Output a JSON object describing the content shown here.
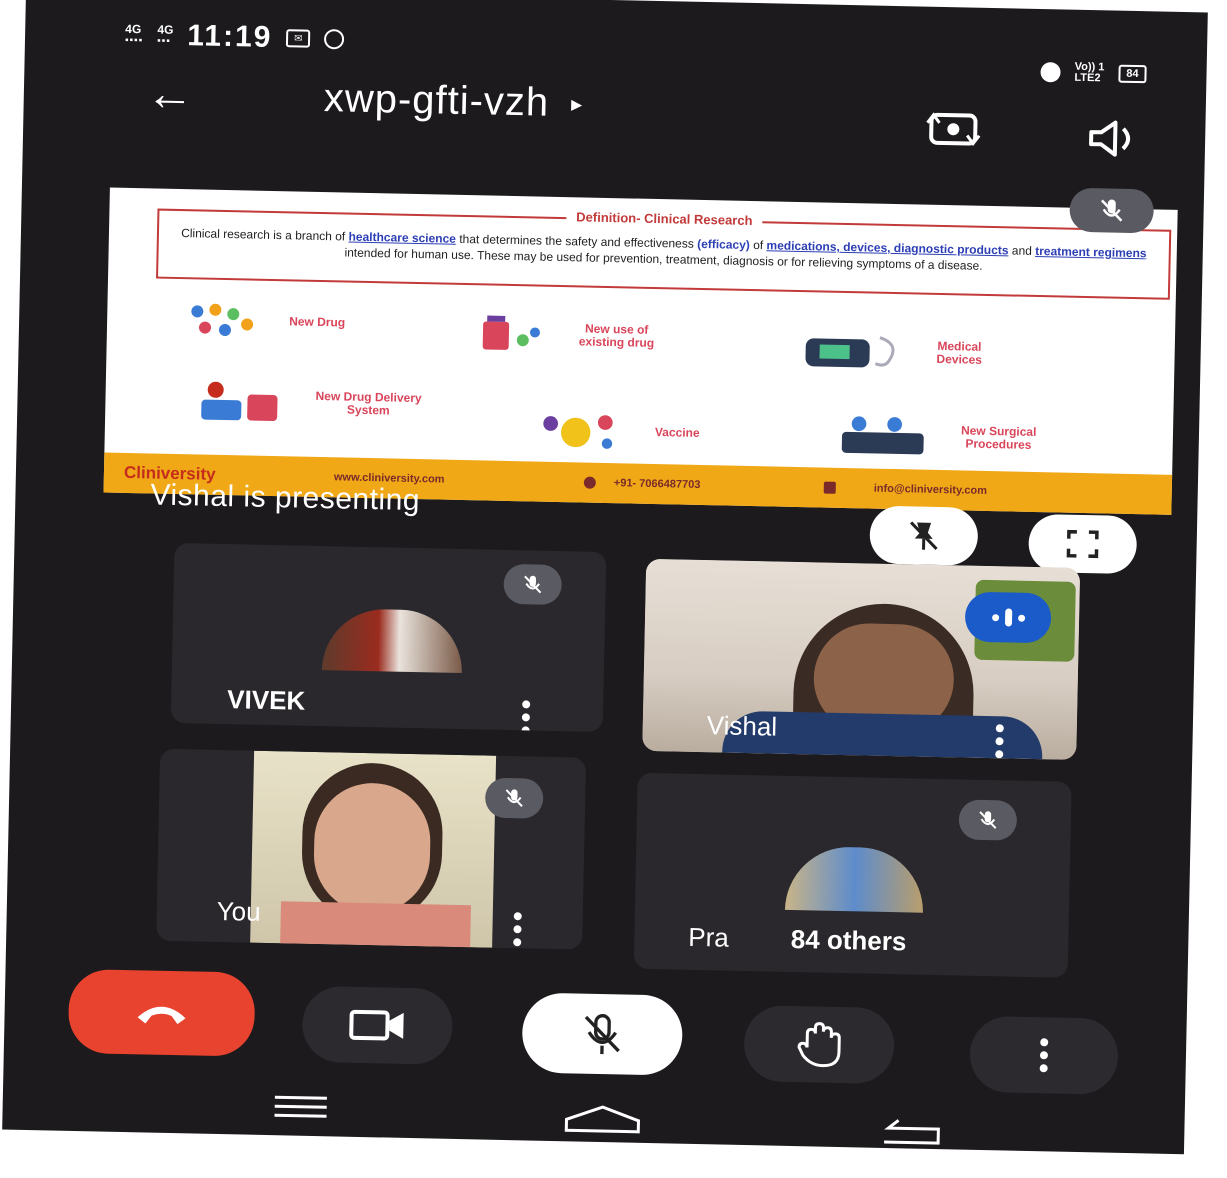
{
  "status_bar": {
    "network_1": "4G",
    "network_2": "4G",
    "time": "11:19",
    "right_network": "Vo)) 1\nLTE2",
    "battery": "84"
  },
  "header": {
    "meeting_code": "xwp-gfti-vzh",
    "code_arrow": "▸"
  },
  "presentation": {
    "slide": {
      "definition_title": "Definition- Clinical Research",
      "def_parts": {
        "p1": "Clinical research is a branch of ",
        "l1": "healthcare science",
        "p2": " that determines the safety and effectiveness ",
        "l2": "(efficacy)",
        "p3": " of ",
        "l3": "medications, devices, diagnostic products",
        "p4": " and ",
        "l4": "treatment regimens",
        "p5": " intended for human use. These may be used for prevention, treatment, diagnosis or for relieving symptoms of a disease."
      },
      "items": [
        {
          "label": "New Drug"
        },
        {
          "label": "New use of\nexisting drug"
        },
        {
          "label": "Medical\nDevices"
        },
        {
          "label": "New Drug Delivery\nSystem"
        },
        {
          "label": "Vaccine"
        },
        {
          "label": "New Surgical\nProcedures"
        }
      ],
      "footer": {
        "logo": "Cliniversity",
        "website": "www.cliniversity.com",
        "phone": "+91- 7066487703",
        "email": "info@cliniversity.com"
      }
    },
    "presenting_text": "Vishal is presenting"
  },
  "participants": [
    {
      "name": "VIVEK",
      "muted": true
    },
    {
      "name": "Vishal",
      "speaking": true
    },
    {
      "name": "You",
      "muted": true
    },
    {
      "name_part1": "Pra",
      "name_part2": "84 others",
      "muted": true
    }
  ],
  "colors": {
    "background": "#1c1a1d",
    "tile": "#2a282c",
    "end_call": "#e8432f",
    "speaking_badge": "#1a5bc9",
    "slide_accent": "#d9455a",
    "slide_footer": "#f0a817"
  },
  "icons": [
    "back-arrow-icon",
    "switch-camera-icon",
    "speaker-icon",
    "mic-off-icon",
    "pin-off-icon",
    "fullscreen-icon",
    "more-vert-icon",
    "end-call-icon",
    "camera-icon",
    "raise-hand-icon",
    "menu-icon",
    "home-icon",
    "back-nav-icon"
  ]
}
